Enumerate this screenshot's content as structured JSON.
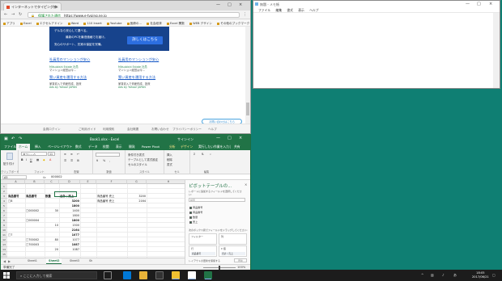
{
  "chrome": {
    "tab_title": "インターネットでタイピング練",
    "address": "https://www.e-typing.ne.jp",
    "secure_label": "保護された通信",
    "bookmarks": [
      "アプリ",
      "Excel",
      "エクセルアドイン",
      "Word",
      "110 Insert",
      "Youtube",
      "医療の…",
      "社会経済",
      "Excel 関数",
      "WEB デザイン",
      "その他のブックマーク"
    ],
    "ad": {
      "text1": "デルなら安心して選べる。",
      "text2": "最新のPCを最低価格でお届け。",
      "text3": "安心のサポート、充実の保証を完備。",
      "button": "詳しくはこちら"
    },
    "ad_col1": {
      "link": "社員用のマンションが安心",
      "source": "Mitsubishi Estate 社員",
      "desc": "マンション経営は今…",
      "link2": "賢い資産を運用する方法",
      "desc2": "家賃収入で資産形成、投資",
      "source2": "Ads by Yahoo! JAPAN"
    },
    "ad_col2": {
      "link": "社員用のマンションが安心",
      "source": "Mitsubishi Estate 社員",
      "desc": "マンション経営は今…",
      "link2": "賢い資産を運用する方法",
      "desc2": "家賃収入で資産形成、投資",
      "source2": "Ads by Yahoo! JAPAN"
    },
    "share_label": "お問い合わせはこちら",
    "footer": [
      "会員ログイン",
      "ご利用ガイド",
      "利用規約",
      "会社概要",
      "お問い合わせ",
      "プライバシーポリシー",
      "ヘルプ"
    ]
  },
  "notepad": {
    "title": "無題 - メモ帳",
    "menu": [
      "ファイル",
      "編集",
      "書式",
      "表示",
      "ヘルプ"
    ]
  },
  "excel": {
    "title": "Book1.xlsx - Excel",
    "signin": "サインイン",
    "tabs": [
      "ファイル",
      "ホーム",
      "挿入",
      "ページレイアウト",
      "数式",
      "データ",
      "校閲",
      "表示",
      "開発",
      "Power Pivot",
      "分析",
      "デザイン",
      "実行したい作業を入力してください",
      "共有"
    ],
    "ribbon": {
      "font_name": "游ゴシック",
      "font_size": "11",
      "groups": [
        "クリップボード",
        "フォント",
        "配置",
        "数値",
        "スタイル",
        "セル",
        "編集"
      ],
      "buttons": {
        "paste": "貼り付け",
        "cond_format": "条件付き書式",
        "table_format": "テーブルとして書式設定",
        "cell_styles": "セルのスタイル",
        "insert": "挿入",
        "delete": "削除",
        "format": "書式"
      }
    },
    "name_box": "A5",
    "formula": "000002",
    "columns": [
      "A",
      "B",
      "C",
      "D",
      "E",
      "F",
      "G",
      "H"
    ],
    "rows": [
      "1",
      "2",
      "3",
      "4",
      "5",
      "6",
      "7",
      "8",
      "9",
      "10",
      "11",
      "12",
      "13",
      "14",
      "15",
      "16"
    ],
    "header_row": {
      "a": "商品番号",
      "b": "商品番号",
      "c": "数量",
      "d": "合計 / 売上",
      "f": "商品番号 売上",
      "g": "3200",
      "f2": "商品番号 売上",
      "g2": "2164"
    },
    "cells": [
      {
        "row": 4,
        "col": "a",
        "text": "□8"
      },
      {
        "row": 4,
        "col": "d",
        "text": "3200",
        "num": true,
        "bold": true
      },
      {
        "row": 5,
        "col": "d",
        "text": "1800",
        "num": true,
        "bold": true
      },
      {
        "row": 6,
        "col": "b",
        "text": "□000002"
      },
      {
        "row": 6,
        "col": "c",
        "text": "30",
        "num": true
      },
      {
        "row": 6,
        "col": "d",
        "text": "1400",
        "num": true
      },
      {
        "row": 7,
        "col": "d",
        "text": "1800",
        "num": true
      },
      {
        "row": 8,
        "col": "b",
        "text": "□000004"
      },
      {
        "row": 8,
        "col": "d",
        "text": "1800",
        "num": true,
        "bold": true
      },
      {
        "row": 9,
        "col": "c",
        "text": "10",
        "num": true
      },
      {
        "row": 9,
        "col": "d",
        "text": "1500",
        "num": true
      },
      {
        "row": 10,
        "col": "d",
        "text": "2164",
        "num": true,
        "bold": true
      },
      {
        "row": 11,
        "col": "a",
        "text": "□7"
      },
      {
        "row": 11,
        "col": "d",
        "text": "1077",
        "num": true,
        "bold": true
      },
      {
        "row": 12,
        "col": "b",
        "text": "□700002"
      },
      {
        "row": 12,
        "col": "c",
        "text": "80",
        "num": true
      },
      {
        "row": 12,
        "col": "d",
        "text": "1077",
        "num": true
      },
      {
        "row": 13,
        "col": "b",
        "text": "□700003"
      },
      {
        "row": 13,
        "col": "d",
        "text": "1087",
        "num": true,
        "bold": true
      },
      {
        "row": 14,
        "col": "c",
        "text": "20",
        "num": true
      },
      {
        "row": 14,
        "col": "d",
        "text": "1087",
        "num": true
      }
    ],
    "sheet_tabs": [
      "Sheet1",
      "Sheet2",
      "Sheet3",
      "Sh"
    ],
    "active_sheet": "Sheet2",
    "status": "準備完了",
    "zoom": "100%"
  },
  "pivot": {
    "title": "ピボットテーブルの...",
    "subtitle": "レポートに追加するフィールドを選択してください:",
    "search_placeholder": "検索",
    "fields": [
      {
        "label": "商品番号",
        "checked": true
      },
      {
        "label": "商品番号",
        "checked": true
      },
      {
        "label": "数量",
        "checked": true
      },
      {
        "label": "売上",
        "checked": true
      }
    ],
    "drag_label": "次のボックス間でフィールドをドラッグしてください:",
    "areas": {
      "filter": "フィルター",
      "columns": "列",
      "rows": "行",
      "values": "Σ 値",
      "rows_item": "商品番号",
      "values_item": "合計 / 売上"
    },
    "defer": "レイアウトの更新を保留する",
    "update": "更新"
  },
  "taskbar": {
    "search_placeholder": "ここに入力して検索",
    "time": "18:05",
    "date": "2017/06/21"
  },
  "colors": {
    "desktop": "#0f7f73",
    "excel_green": "#217346",
    "ad_blue": "#17438c"
  }
}
